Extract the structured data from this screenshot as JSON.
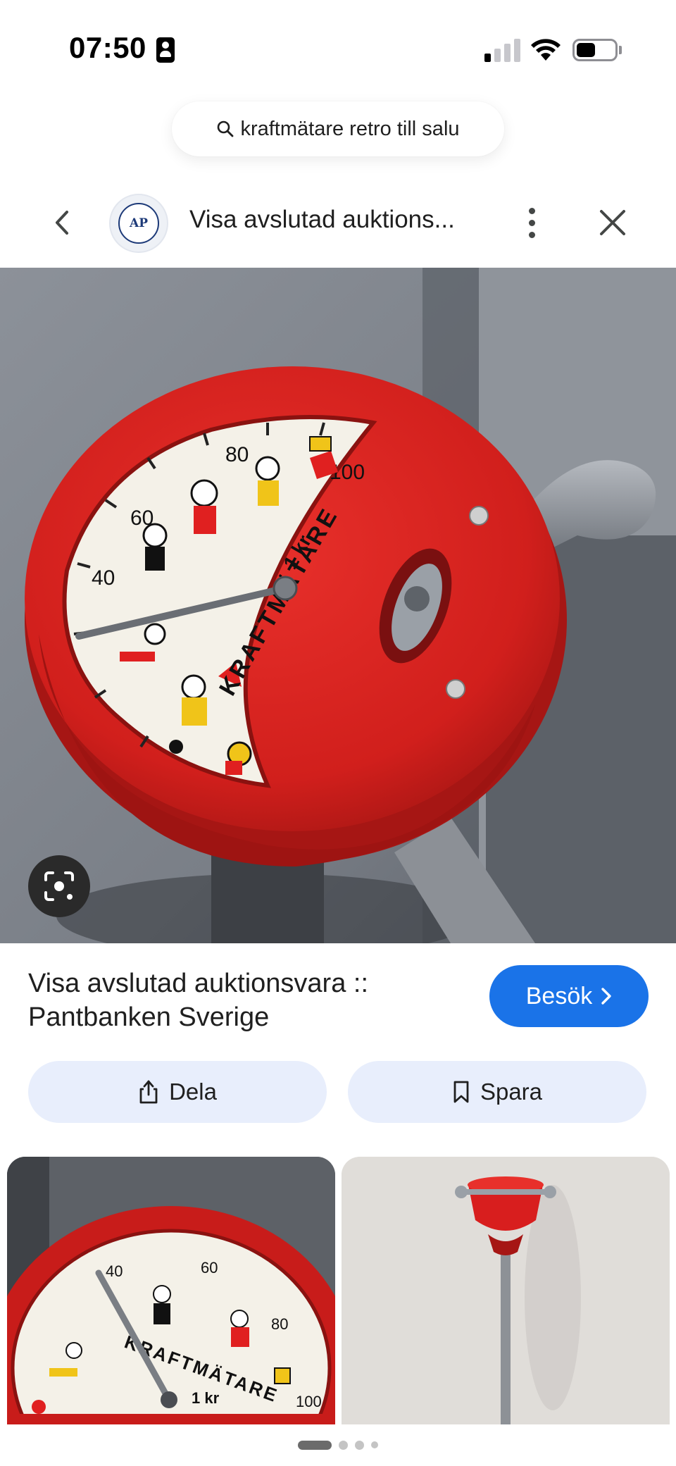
{
  "status_bar": {
    "time": "07:50",
    "signal_bars_active": 1,
    "signal_bars_total": 4,
    "battery_level": 0.4
  },
  "search": {
    "query": "kraftmätare retro till salu",
    "icon": "search-icon"
  },
  "header": {
    "title": "Visa avslutad auktions...",
    "back_icon": "chevron-left-icon",
    "more_icon": "more-vertical-icon",
    "close_icon": "close-icon",
    "logo_text": "AP"
  },
  "main_image": {
    "dial": {
      "title": "KRAFTMÄTARE",
      "price": "1 kr",
      "labels": [
        "40",
        "60",
        "80",
        "100"
      ]
    }
  },
  "result": {
    "title": "Visa avslutad auktionsvara :: Pantbanken Sverige",
    "visit_label": "Besök",
    "share_label": "Dela",
    "save_label": "Spara"
  },
  "thumbnails": {
    "thumb1_dial": {
      "title": "KRAFTMÄTARE",
      "price": "1 kr",
      "labels": [
        "40",
        "60",
        "80",
        "100"
      ]
    }
  },
  "pagination": {
    "pages": 4,
    "current": 1
  },
  "colors": {
    "accent_blue": "#1a73e8",
    "pill_bg": "#e8eefc",
    "machine_red": "#d81e1e"
  }
}
